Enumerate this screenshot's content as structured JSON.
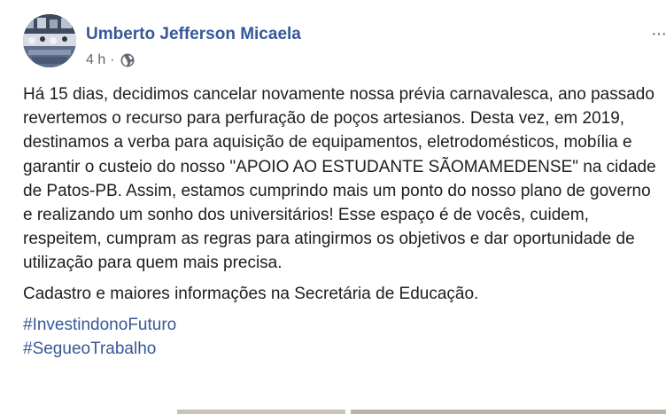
{
  "post": {
    "author": "Umberto Jefferson Micaela",
    "time": "4 h",
    "separator": "·",
    "privacy_icon": "globe-icon",
    "options_icon": "more-options-icon",
    "body_paragraph_1": "Há 15 dias, decidimos cancelar novamente nossa prévia carnavalesca, ano passado revertemos o recurso para perfuração de poços artesianos. Desta vez, em 2019, destinamos a verba para aquisição de equipamentos, eletrodomésticos, mobília e garantir o custeio do nosso \"APOIO AO ESTUDANTE SÃOMAMEDENSE\" na cidade de Patos-PB. Assim, estamos cumprindo mais um ponto do nosso plano de governo e realizando um sonho dos universitários! Esse espaço é de vocês, cuidem, respeitem, cumpram as regras para atingirmos os objetivos e dar oportunidade de utilização para quem mais precisa.",
    "body_paragraph_2": "Cadastro e maiores informações na Secretária de Educação.",
    "hashtags": [
      "#InvestindonoFuturo",
      "#SegueoTrabalho"
    ]
  },
  "colors": {
    "author": "#385898",
    "meta": "#616770",
    "text": "#1c1e21",
    "hashtag": "#385898"
  }
}
